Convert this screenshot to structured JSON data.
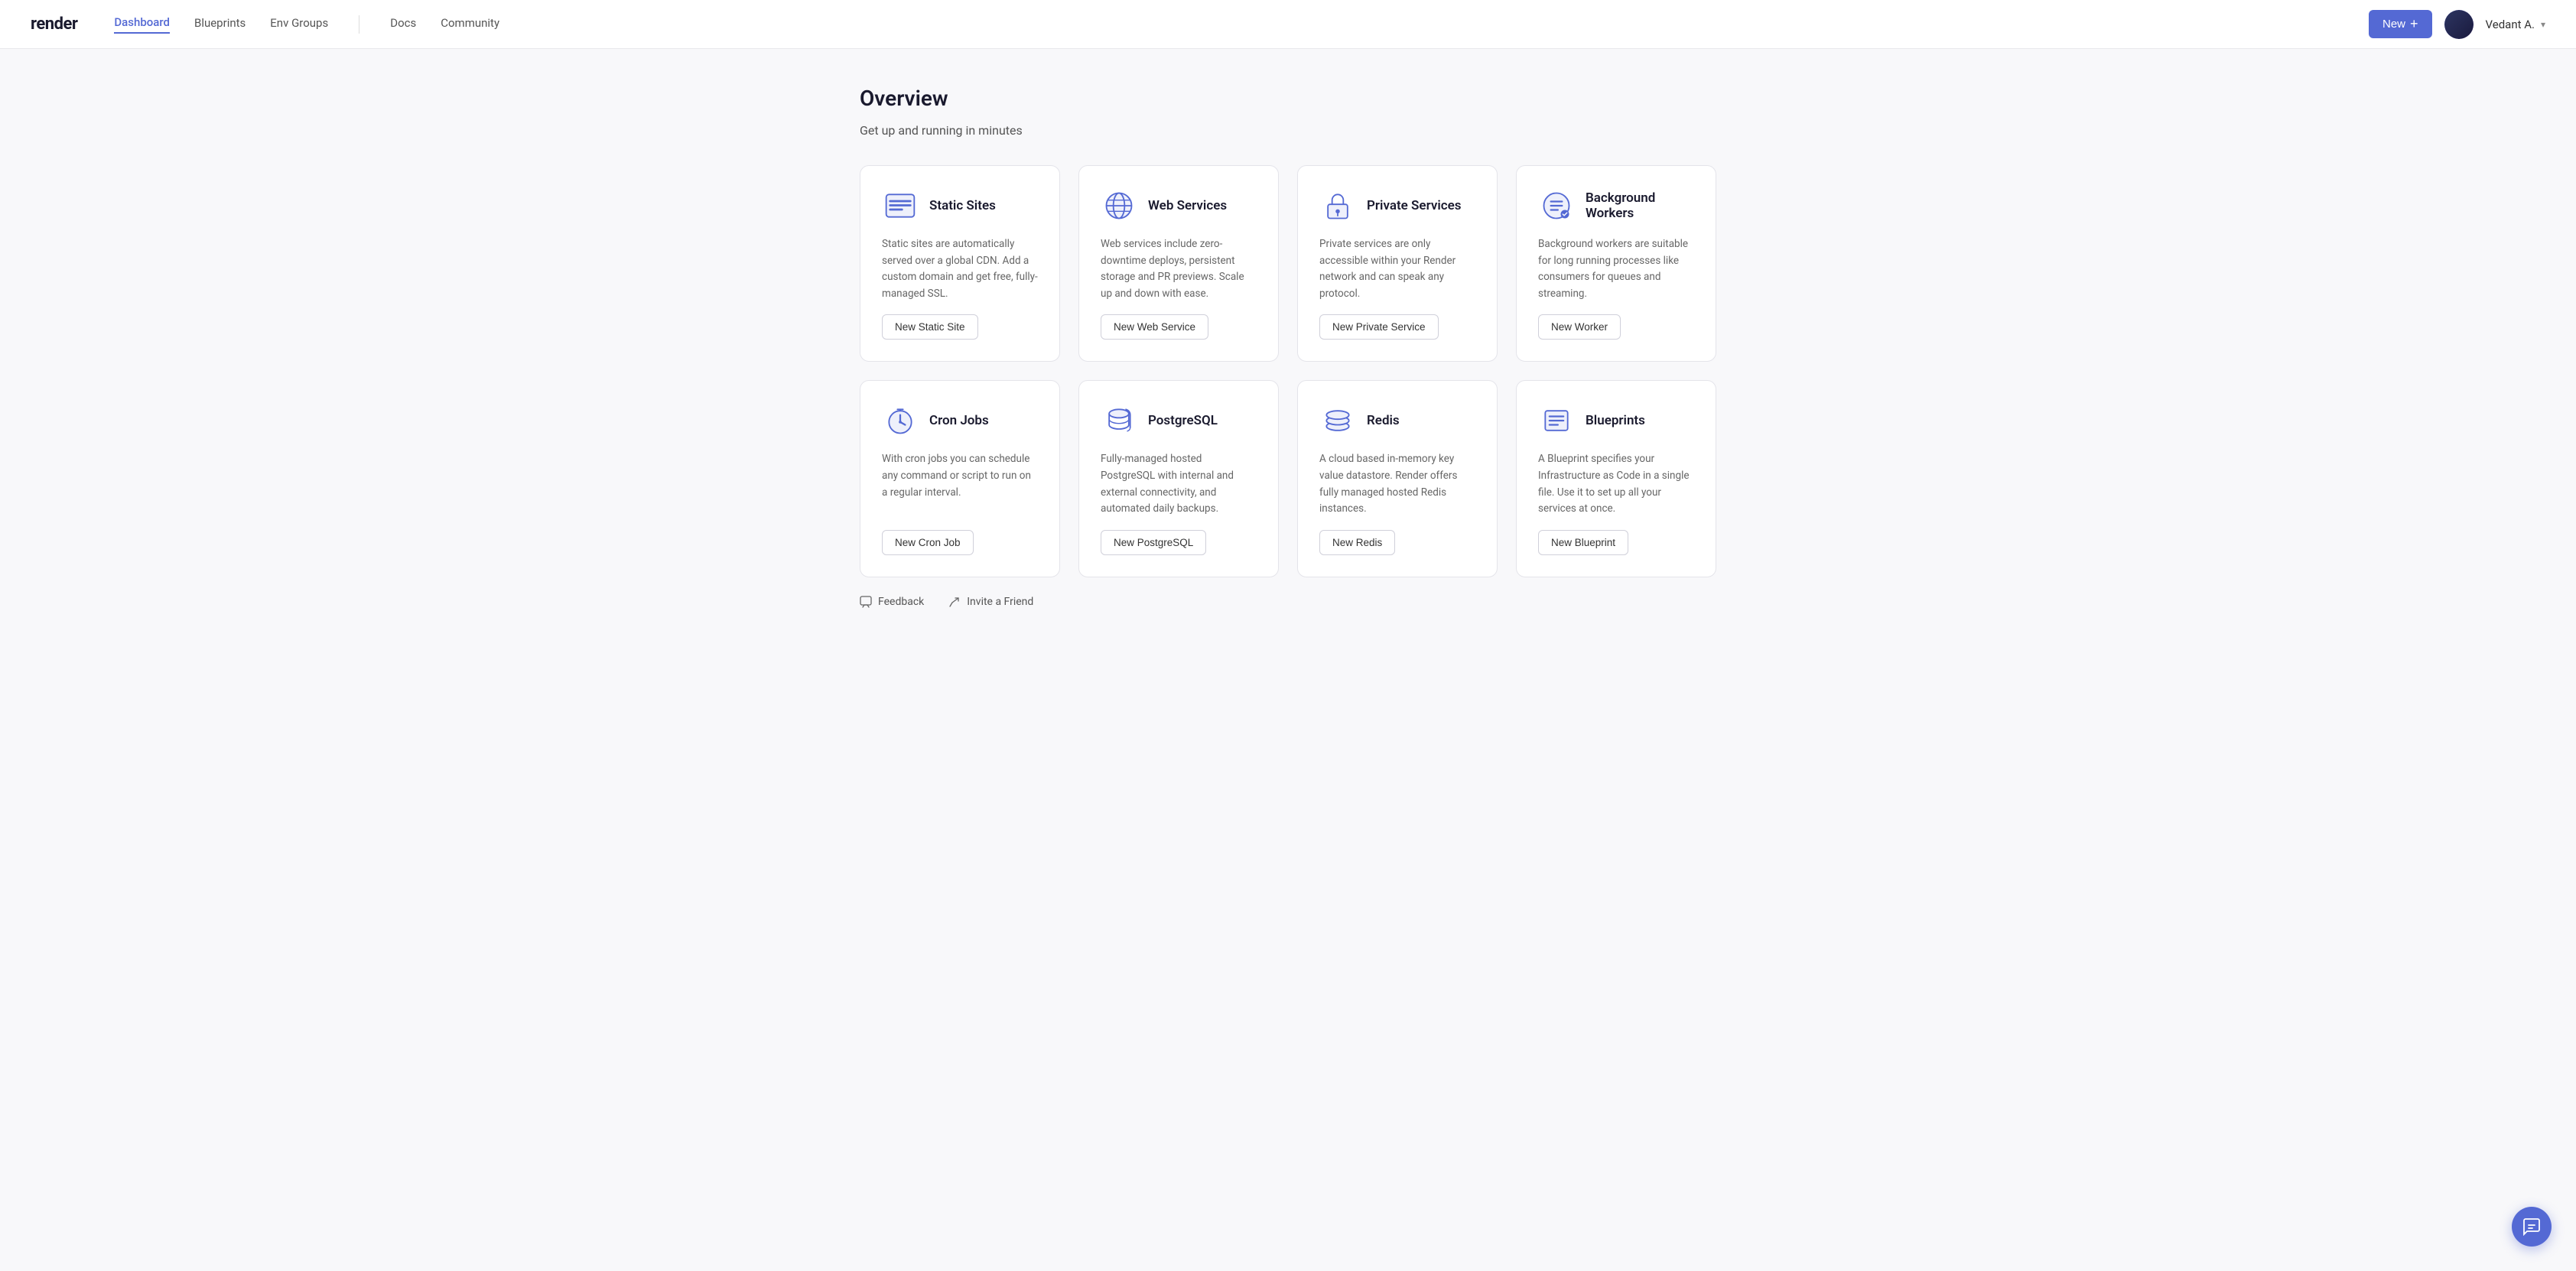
{
  "nav": {
    "logo": "render",
    "links": [
      {
        "label": "Dashboard",
        "active": true
      },
      {
        "label": "Blueprints",
        "active": false
      },
      {
        "label": "Env Groups",
        "active": false
      },
      {
        "label": "Docs",
        "active": false
      },
      {
        "label": "Community",
        "active": false
      }
    ],
    "new_button": "New",
    "user_name": "Vedant A."
  },
  "page": {
    "title": "Overview",
    "subtitle": "Get up and running in minutes"
  },
  "cards_row1": [
    {
      "id": "static-sites",
      "title": "Static Sites",
      "description": "Static sites are automatically served over a global CDN. Add a custom domain and get free, fully-managed SSL.",
      "button": "New Static Site"
    },
    {
      "id": "web-services",
      "title": "Web Services",
      "description": "Web services include zero-downtime deploys, persistent storage and PR previews. Scale up and down with ease.",
      "button": "New Web Service"
    },
    {
      "id": "private-services",
      "title": "Private Services",
      "description": "Private services are only accessible within your Render network and can speak any protocol.",
      "button": "New Private Service"
    },
    {
      "id": "background-workers",
      "title": "Background Workers",
      "description": "Background workers are suitable for long running processes like consumers for queues and streaming.",
      "button": "New Worker"
    }
  ],
  "cards_row2": [
    {
      "id": "cron-jobs",
      "title": "Cron Jobs",
      "description": "With cron jobs you can schedule any command or script to run on a regular interval.",
      "button": "New Cron Job"
    },
    {
      "id": "postgresql",
      "title": "PostgreSQL",
      "description": "Fully-managed hosted PostgreSQL with internal and external connectivity, and automated daily backups.",
      "button": "New PostgreSQL"
    },
    {
      "id": "redis",
      "title": "Redis",
      "description": "A cloud based in-memory key value datastore. Render offers fully managed hosted Redis instances.",
      "button": "New Redis"
    },
    {
      "id": "blueprints",
      "title": "Blueprints",
      "description": "A Blueprint specifies your Infrastructure as Code in a single file. Use it to set up all your services at once.",
      "button": "New Blueprint"
    }
  ],
  "footer": {
    "feedback": "Feedback",
    "invite": "Invite a Friend"
  },
  "accent_color": "#5469d4"
}
